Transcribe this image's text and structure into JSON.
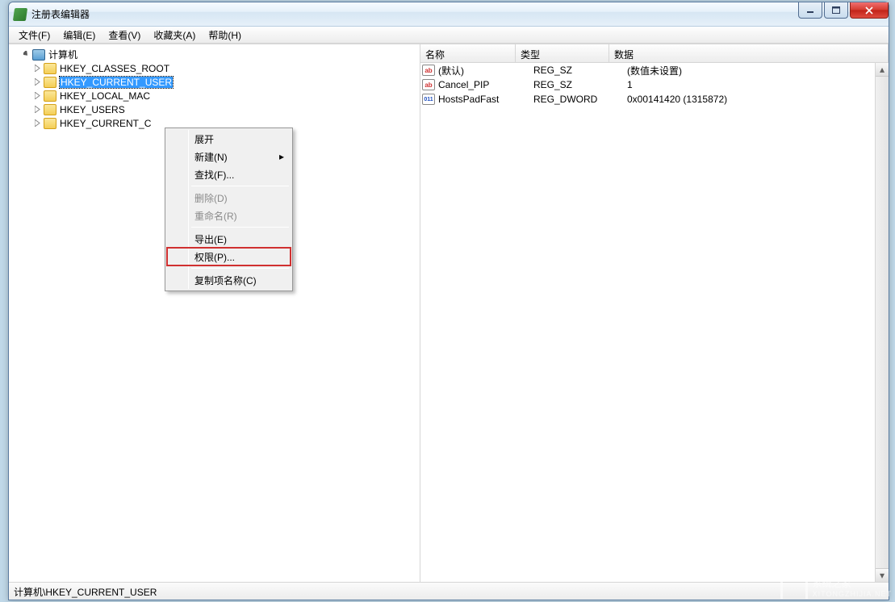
{
  "window": {
    "title": "注册表编辑器"
  },
  "menubar": [
    {
      "label": "文件(F)"
    },
    {
      "label": "编辑(E)"
    },
    {
      "label": "查看(V)"
    },
    {
      "label": "收藏夹(A)"
    },
    {
      "label": "帮助(H)"
    }
  ],
  "tree": {
    "root": "计算机",
    "keys": [
      "HKEY_CLASSES_ROOT",
      "HKEY_CURRENT_USER",
      "HKEY_LOCAL_MACHINE",
      "HKEY_USERS",
      "HKEY_CURRENT_CONFIG"
    ],
    "visible_keys": [
      "HKEY_CLASSES_ROOT",
      "HKEY_CURRENT_USER",
      "HKEY_LOCAL_MAC",
      "HKEY_USERS",
      "HKEY_CURRENT_C"
    ],
    "selected_index": 1
  },
  "list": {
    "columns": {
      "name": "名称",
      "type": "类型",
      "data": "数据"
    },
    "rows": [
      {
        "icon": "ab",
        "name": "(默认)",
        "type": "REG_SZ",
        "data": "(数值未设置)"
      },
      {
        "icon": "ab",
        "name": "Cancel_PIP",
        "type": "REG_SZ",
        "data": "1"
      },
      {
        "icon": "dw",
        "name": "HostsPadFast",
        "type": "REG_DWORD",
        "data": "0x00141420 (1315872)"
      }
    ]
  },
  "context_menu": {
    "expand": "展开",
    "new": "新建(N)",
    "find": "查找(F)...",
    "delete": "删除(D)",
    "rename": "重命名(R)",
    "export": "导出(E)",
    "permissions": "权限(P)...",
    "copy_key_name": "复制项名称(C)"
  },
  "statusbar": {
    "path": "计算机\\HKEY_CURRENT_USER"
  },
  "watermark": {
    "line1": "系统之家",
    "line2": "XITONGZHIJIA.NET"
  },
  "icon_glyphs": {
    "ab": "ab",
    "dw": "011"
  }
}
